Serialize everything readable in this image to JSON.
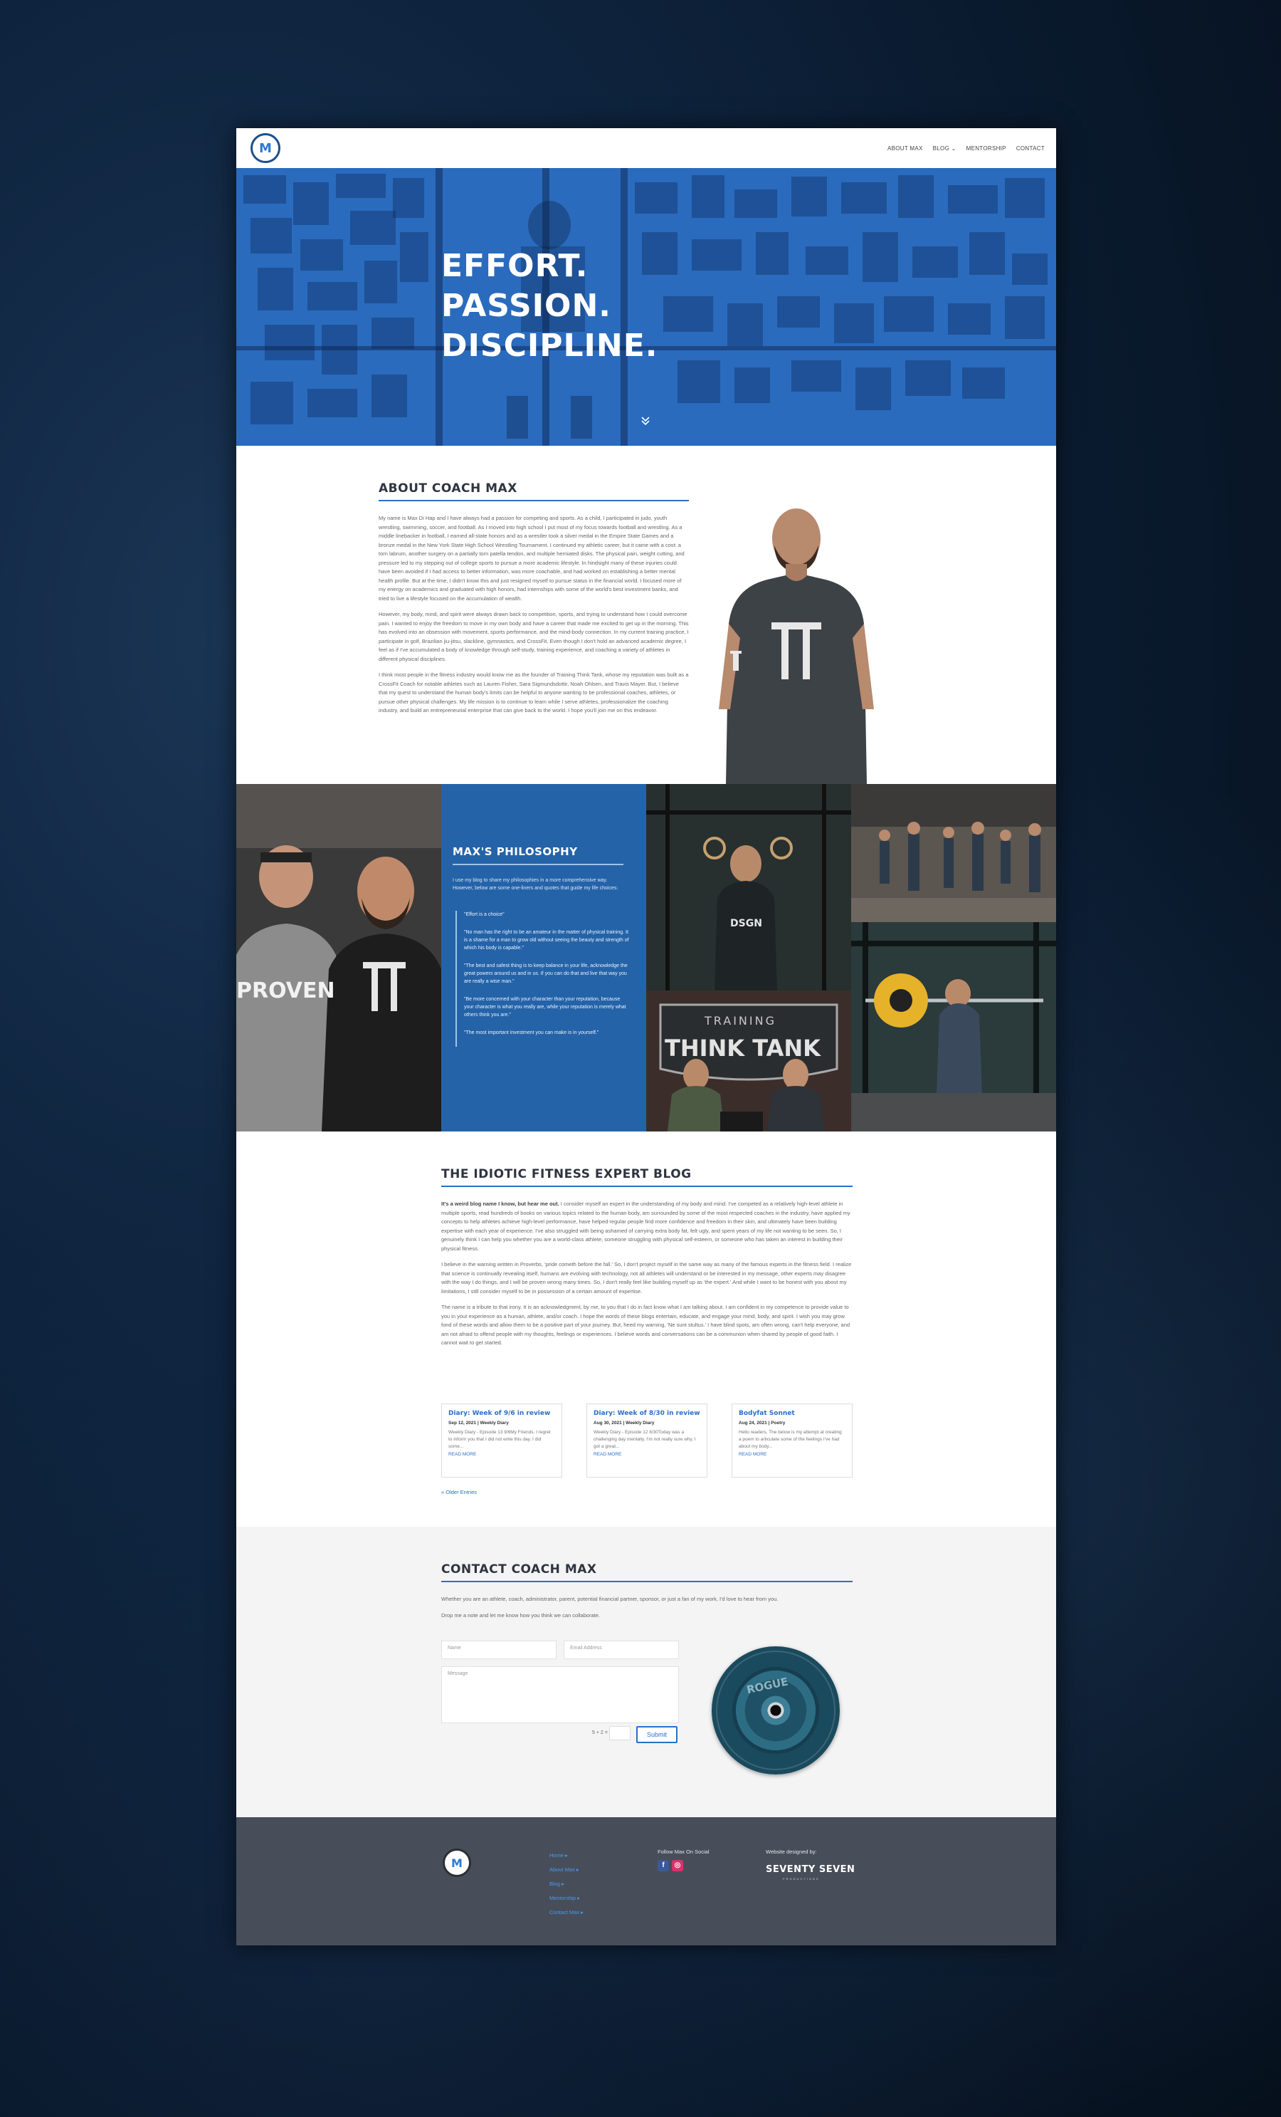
{
  "header": {
    "logo_letters": "M",
    "nav": [
      "ABOUT MAX",
      "BLOG ⌄",
      "MENTORSHIP",
      "CONTACT"
    ]
  },
  "hero": {
    "lines": [
      "EFFORT.",
      "PASSION.",
      "DISCIPLINE."
    ],
    "scroll_icon": "double-chevron-down-icon",
    "accent": "#2667b8"
  },
  "about": {
    "heading": "ABOUT COACH MAX",
    "paragraphs": [
      "My name is Max Di Hap and I have always had a passion for competing and sports.  As a child, I participated in judo, youth wrestling, swimming, soccer, and football.  As I moved into high school I put most of my focus towards football and wrestling.  As a middle linebacker in football, I earned all-state honors and as a wrestler took a silver medal in the Empire State Games and a bronze medal in the New York State High School Wrestling Tournament.  I continued my athletic career, but it came with a cost: a torn labrum, another surgery on a partially torn patella tendon, and multiple herniated disks. The physical pain, weight cutting, and pressure led to my stepping out of college sports to pursue a more academic lifestyle.  In hindsight many of these injuries could have been avoided if I had access to better information, was more coachable, and had worked on establishing a better mental health profile.  But at the time, I didn't know this and just resigned myself to pursue status in the financial world.  I focused more of my energy on academics and graduated with high honors, had internships with some of the world's best investment banks, and tried to live a lifestyle focused on the accumulation of wealth.",
      "However, my body, mind, and spirit were always drawn back to competition, sports, and trying to understand how I could overcome pain.  I wanted to enjoy the freedom to move in my own body and have a career that made me excited to get up in the morning.  This has evolved into an obsession with movement, sports performance, and the mind-body connection.  In my current training practice, I participate in golf, Brazilian jiu-jitsu, slackline, gymnastics, and CrossFit. Even though I don't hold an advanced academic degree, I feel as if I've accumulated a body of knowledge through self-study, training experience, and coaching a variety of athletes in different physical disciplines.",
      "I think most people in the fitness industry would know me as the founder of Training Think Tank, whose my reputation was built as a CrossFit Coach for notable athletes such as Lauren Fisher, Sara Sigmundsdottir, Noah Ohlsen, and Travis Mayer.  But, I believe that my quest to understand the human body's limits can be helpful to anyone wanting to be professional coaches, athletes, or pursue other physical challenges.  My life mission is to continue to learn while I serve athletes, professionalize the coaching industry, and build an entrepreneurial enterprise that can give back to the world.  I hope you'll join me on this endeavor."
    ]
  },
  "philosophy": {
    "heading": "MAX'S PHILOSOPHY",
    "intro": "I use my blog to share my philosophies in a more comprehensive way. However, below are some one-liners and quotes that guide my life choices:",
    "quotes": [
      "\"Effort is a choice\"",
      "\"No man has the right to be an amateur in the matter of physical training. It is a shame for a man to grow old without seeing the beauty and strength of which his body is capable.\"",
      "\"The best and safest thing is to keep balance in your life, acknowledge the great powers around us and in us.  If you can do that and live that way you are really a wise man.\"",
      "\"Be more concerned with your character than your reputation, because your character is what you really are, while your reputation is merely what others think you are.\"",
      "\"The most important investment you can make is in yourself.\""
    ],
    "bg": "#2563a8",
    "sign_top": "TRAINING",
    "sign_main": "THINK TANK",
    "shirt_left": "PROVEN",
    "shirt_gym": "DSGN"
  },
  "blog": {
    "heading": "THE IDIOTIC FITNESS EXPERT BLOG",
    "lead": "It's a weird blog name I know, but hear me out.",
    "paragraphs": [
      "I consider myself an expert in the understanding of my body and mind.  I've competed as a relatively high-level athlete in multiple sports, read hundreds of books on various topics related to the human body, am surrounded by some of the most respected coaches in the industry, have applied my concepts to help athletes achieve high-level performance, have helped regular people find more confidence and freedom in their skin, and ultimately have been building expertise with each year of experience.  I've also struggled with being ashamed of carrying extra body fat, felt ugly, and spent years of my life not wanting to be seen.  So, I genuinely think I can help you whether you are a world-class athlete, someone struggling with physical self-esteem, or someone who has taken an interest in building their physical fitness.",
      "I believe in the warning written in Proverbs, 'pride cometh before the fall.' So, I don't project myself in the same way as many of the famous experts in the fitness field.  I realize that science is continually revealing itself, humans are evolving with technology, not all athletes will understand or be interested in my message, other experts may disagree with the way I do things, and I will be proven wrong many times.  So, I don't really feel like building myself up as 'the expert.'  And while I want to be honest with you about my limitations, I still consider myself to be in possession of a certain amount of expertise.",
      "The name is a tribute to that irony.  It is an acknowledgment, by me, to you that I do in fact know what I am talking about.  I am confident in my competence to provide value to you in your experience as a human, athlete, and/or coach. I hope the words of these blogs entertain, educate, and engage your mind, body, and spirit.  I wish you may grow fond of these words and allow them to be a positive part of your journey.  But, heed my warning, 'Ne sunt stultus.'  I have blind spots, am often wrong, can't help everyone, and am not afraid to offend people with my thoughts, feelings or experiences.  I believe words and conversations can be a communion when shared by people of good faith. I cannot wait to get started."
    ],
    "cards": [
      {
        "title": "Diary: Week of 9/6 in review",
        "meta": "Sep 12, 2021 | Weekly Diary",
        "excerpt": "Weekly Diary - Episode 13 9/6My Friends, I regret to inform you that I did not write this day.  I did some...",
        "more": "READ MORE"
      },
      {
        "title": "Diary: Week of 8/30 in review",
        "meta": "Aug 30, 2021 | Weekly Diary",
        "excerpt": "Weekly Diary - Episode 12 8/30Today was a challenging day mentally.  I'm not really sure why.  I got a great...",
        "more": "READ MORE"
      },
      {
        "title": "Bodyfat Sonnet",
        "meta": "Aug 24, 2021 | Poetry",
        "excerpt": "Hello readers,  The below is my attempt at creating a poem to articulate some of the feelings I've had about my body...",
        "more": "READ MORE"
      }
    ],
    "older": "« Older Entries"
  },
  "contact": {
    "heading": "CONTACT COACH MAX",
    "intro1": "Whether you are an athlete, coach, administrator, parent, potential financial partner, sponsor, or just a fan of my work, I'd love to hear from you.",
    "intro2": "Drop me a note and let me know how you think we can collaborate.",
    "name_placeholder": "Name",
    "email_placeholder": "Email Address",
    "message_placeholder": "Message",
    "captcha": "5 + 2 =",
    "submit": "Submit",
    "plate_text": "ROGUE"
  },
  "footer": {
    "logo_letters": "M",
    "links": [
      "Home ▸",
      "About Max ▸",
      "Blog ▸",
      "Mentorship ▸",
      "Contact Max ▸"
    ],
    "social_label": "Follow Max On Social",
    "social_icons": [
      "facebook-icon",
      "instagram-icon"
    ],
    "designed_label": "Website designed by:",
    "designer": "SEVENTY SEVEN",
    "designer_sub": "PRODUCTIONS",
    "bg": "#474e59"
  }
}
